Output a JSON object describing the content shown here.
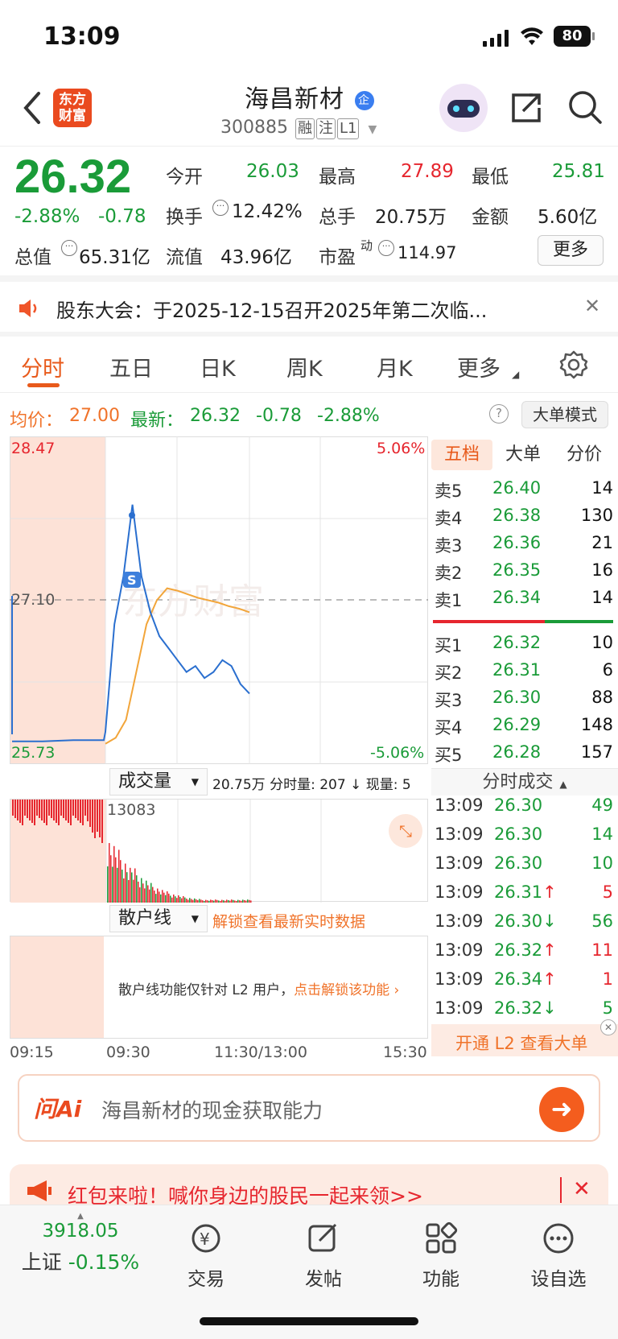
{
  "status": {
    "time": "13:09",
    "battery": "80"
  },
  "header": {
    "back_icon": "chevron-left-icon",
    "logo_text_1": "东方",
    "logo_text_2": "财富",
    "name": "海昌新材",
    "badge": "企",
    "code": "300885",
    "tags": [
      "融",
      "注",
      "L1"
    ]
  },
  "quote": {
    "price": "26.32",
    "pct": "-2.88%",
    "chg": "-0.78",
    "open_label": "今开",
    "open": "26.03",
    "high_label": "最高",
    "high": "27.89",
    "low_label": "最低",
    "low": "25.81",
    "turnover_label": "换手",
    "turnover": "12.42%",
    "volume_label": "总手",
    "volume": "20.75万",
    "amount_label": "金额",
    "amount": "5.60亿",
    "mktcap_label": "总值",
    "mktcap": "65.31亿",
    "float_label": "流值",
    "float": "43.96亿",
    "pe_label": "市盈",
    "pe_sup": "动",
    "pe": "114.97",
    "more": "更多"
  },
  "notice": {
    "text": "股东大会：于2025-12-15召开2025年第二次临...",
    "close": "✕"
  },
  "tabs": [
    "分时",
    "五日",
    "日K",
    "周K",
    "月K",
    "更多"
  ],
  "info": {
    "avg_label": "均价：",
    "avg": "27.00",
    "last_label": "最新：",
    "last": "26.32",
    "chg": "-0.78",
    "pct": "-2.88%",
    "help": "?",
    "mode_btn": "大单模式"
  },
  "chart": {
    "y_top": "28.47",
    "y_mid": "27.10",
    "y_bottom": "25.73",
    "pct_top": "5.06%",
    "pct_bottom": "-5.06%",
    "watermark": "东方财富",
    "s_marker": "S",
    "vol_label": "成交量",
    "vol_info": "20.75万 分时量: 207 ↓ 现量: 5",
    "vol_max": "13083",
    "retail_label": "散户线",
    "retail_unlock": "解锁查看最新实时数据",
    "retail_msg": "散户线功能仅针对 L2 用户，",
    "retail_link": "点击解锁该功能",
    "x_labels": [
      "09:15",
      "09:30",
      "11:30/13:00",
      "15:30"
    ]
  },
  "chart_data": {
    "type": "line",
    "title": "",
    "xlabel": "",
    "ylabel": "",
    "ylim": [
      25.73,
      28.47
    ],
    "prev_close": 27.1,
    "series": [
      {
        "name": "最新",
        "values": [
          25.92,
          25.92,
          25.93,
          25.93,
          26.0,
          26.9,
          27.3,
          27.9,
          27.3,
          27.0,
          26.8,
          26.7,
          26.6,
          26.5,
          26.55,
          26.45,
          26.5,
          26.6,
          26.55,
          26.4,
          26.32
        ]
      },
      {
        "name": "均价",
        "values": [
          25.9,
          25.95,
          26.1,
          26.5,
          26.9,
          27.1,
          27.2,
          27.18,
          27.15,
          27.12,
          27.1,
          27.08,
          27.05,
          27.03,
          27.0
        ]
      }
    ]
  },
  "order_book": {
    "tabs": [
      "五档",
      "大单",
      "分价"
    ],
    "sells": [
      {
        "k": "卖5",
        "p": "26.40",
        "v": "14"
      },
      {
        "k": "卖4",
        "p": "26.38",
        "v": "130"
      },
      {
        "k": "卖3",
        "p": "26.36",
        "v": "21"
      },
      {
        "k": "卖2",
        "p": "26.35",
        "v": "16"
      },
      {
        "k": "卖1",
        "p": "26.34",
        "v": "14"
      }
    ],
    "buys": [
      {
        "k": "买1",
        "p": "26.32",
        "v": "10"
      },
      {
        "k": "买2",
        "p": "26.31",
        "v": "6"
      },
      {
        "k": "买3",
        "p": "26.30",
        "v": "88"
      },
      {
        "k": "买4",
        "p": "26.29",
        "v": "148"
      },
      {
        "k": "买5",
        "p": "26.28",
        "v": "157"
      }
    ]
  },
  "trades": {
    "title": "分时成交",
    "rows": [
      {
        "t": "13:09",
        "p": "26.30",
        "v": "49",
        "arrow": ""
      },
      {
        "t": "13:09",
        "p": "26.30",
        "v": "14",
        "arrow": ""
      },
      {
        "t": "13:09",
        "p": "26.30",
        "v": "10",
        "arrow": ""
      },
      {
        "t": "13:09",
        "p": "26.31",
        "v": "5",
        "arrow": "↑"
      },
      {
        "t": "13:09",
        "p": "26.30",
        "v": "56",
        "arrow": "↓"
      },
      {
        "t": "13:09",
        "p": "26.32",
        "v": "11",
        "arrow": "↑"
      },
      {
        "t": "13:09",
        "p": "26.34",
        "v": "1",
        "arrow": "↑"
      },
      {
        "t": "13:09",
        "p": "26.32",
        "v": "5",
        "arrow": "↓"
      }
    ],
    "l2_link": "开通 L2 查看大单"
  },
  "ai": {
    "logo": "问Ai",
    "placeholder": "海昌新材的现金获取能力"
  },
  "promo": {
    "text": "红包来啦！喊你身边的股民一起来领>>"
  },
  "bottom_nav": {
    "index_value": "3918.05",
    "index_name": "上证",
    "index_pct": "-0.15%",
    "items": [
      "交易",
      "发帖",
      "功能",
      "设自选"
    ]
  }
}
